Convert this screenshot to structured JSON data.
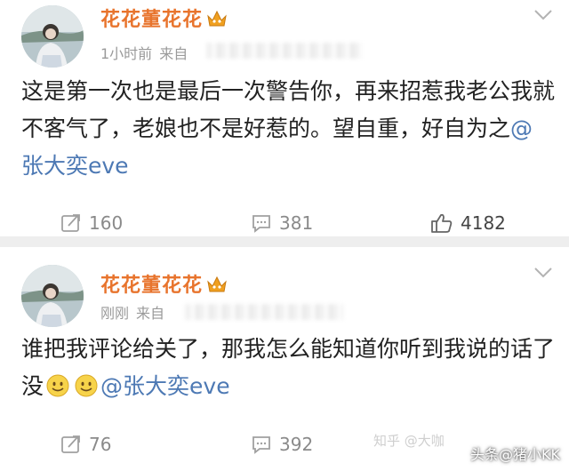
{
  "posts": [
    {
      "username": "花花董花花",
      "time": "1小时前",
      "source_prefix": "来自",
      "content_text": "这是第一次也是最后一次警告你，再来招惹我老公我就不客气了，老娘也不是好惹的。望自重，好自为之",
      "mention": "@张大奕eve",
      "reposts": "160",
      "comments": "381",
      "likes": "4182"
    },
    {
      "username": "花花董花花",
      "time": "刚刚",
      "source_prefix": "来自",
      "content_text": "谁把我评论给关了，那我怎么能知道你听到我说的话了没",
      "emoji_names": [
        "smile-emoji",
        "smile-emoji"
      ],
      "mention": "@张大奕eve",
      "reposts": "76",
      "comments": "392"
    }
  ],
  "watermark": {
    "zhihu": "知乎 @大咖",
    "toutiao": "头条@猪小KK"
  },
  "colors": {
    "username": "#e8742d",
    "mention": "#4d79b4",
    "meta": "#9a9a9a",
    "background_gap": "#eeeeee"
  }
}
